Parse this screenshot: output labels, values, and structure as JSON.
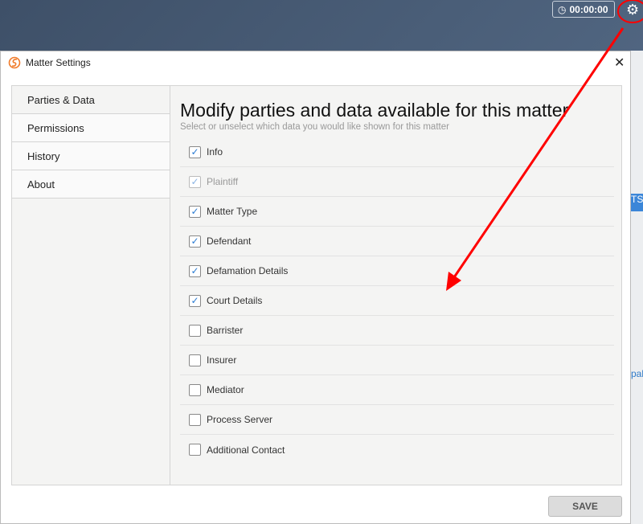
{
  "header": {
    "timer": "00:00:00",
    "timer_icon": "clock-icon",
    "settings_icon": "gear-icon"
  },
  "background": {
    "tab_fragment": "TS",
    "link_fragment": "pal"
  },
  "dialog": {
    "title": "Matter Settings",
    "close_icon": "close-icon",
    "sidebar": [
      {
        "label": "Parties & Data",
        "active": true
      },
      {
        "label": "Permissions"
      },
      {
        "label": "History"
      },
      {
        "label": "About"
      }
    ],
    "heading": "Modify parties and data available for this matter",
    "subheading": "Select or unselect which data you would like shown for this matter",
    "items": [
      {
        "label": "Info",
        "checked": true
      },
      {
        "label": "Plaintiff",
        "checked": true,
        "disabled": true
      },
      {
        "label": "Matter Type",
        "checked": true
      },
      {
        "label": "Defendant",
        "checked": true
      },
      {
        "label": "Defamation Details",
        "checked": true
      },
      {
        "label": "Court Details",
        "checked": true
      },
      {
        "label": "Barrister",
        "checked": false
      },
      {
        "label": "Insurer",
        "checked": false
      },
      {
        "label": "Mediator",
        "checked": false
      },
      {
        "label": "Process Server",
        "checked": false
      },
      {
        "label": "Additional Contact",
        "checked": false
      }
    ],
    "save_label": "SAVE"
  },
  "colors": {
    "accent": "#2b7cd3",
    "annotation": "#ff0000",
    "logo": "#f07b2a"
  }
}
